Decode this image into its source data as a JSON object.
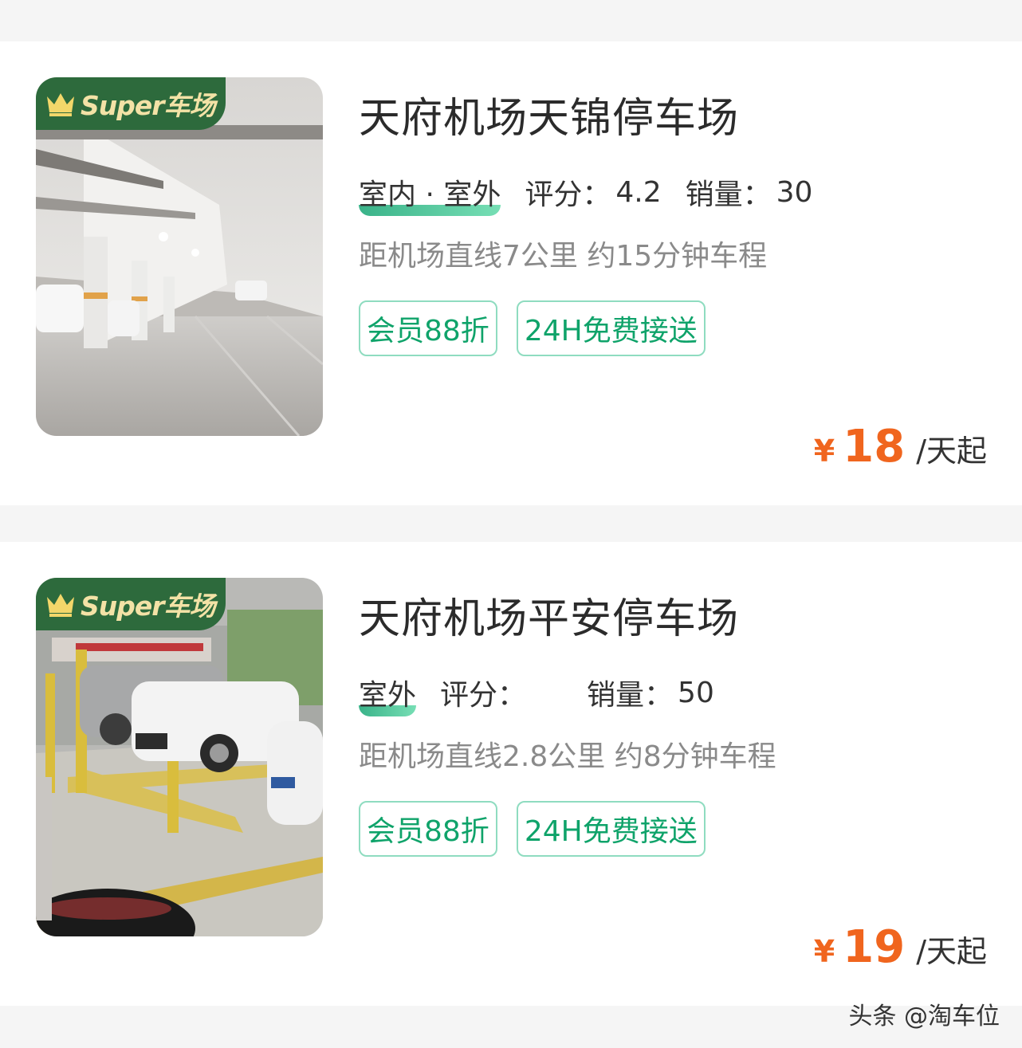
{
  "listings": [
    {
      "badge": "Super车场",
      "title": "天府机场天锦停车场",
      "location_type": "室内 · 室外",
      "rating_label": "评分：",
      "rating_value": "4.2",
      "sales_label": "销量：",
      "sales_value": "30",
      "distance": "距机场直线7公里 约15分钟车程",
      "tags": [
        "会员88折",
        "24H免费接送"
      ],
      "price_currency": "¥",
      "price_amount": "18",
      "price_unit": "/天起"
    },
    {
      "badge": "Super车场",
      "title": "天府机场平安停车场",
      "location_type": "室外",
      "rating_label": "评分：",
      "rating_value": "",
      "sales_label": "销量：",
      "sales_value": "50",
      "distance": "距机场直线2.8公里 约8分钟车程",
      "tags": [
        "会员88折",
        "24H免费接送"
      ],
      "price_currency": "¥",
      "price_amount": "19",
      "price_unit": "/天起"
    }
  ],
  "watermark": "头条 @淘车位",
  "colors": {
    "accent_green": "#0fa36a",
    "badge_green": "#2d6a3c",
    "price_orange": "#f0651e"
  },
  "icons": [
    "crown-icon"
  ]
}
